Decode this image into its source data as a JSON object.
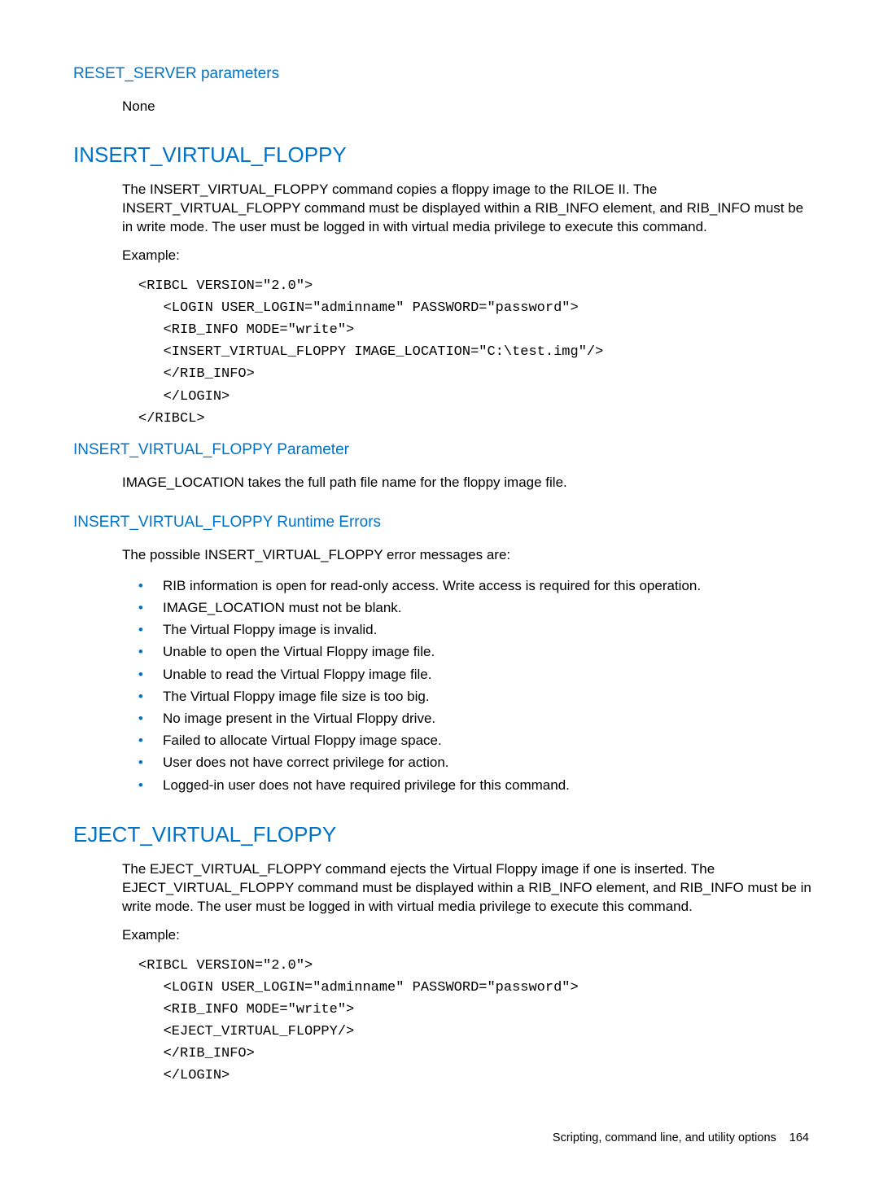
{
  "sections": {
    "reset_server_params": {
      "heading": "RESET_SERVER parameters",
      "body": "None"
    },
    "insert_virtual_floppy": {
      "heading": "INSERT_VIRTUAL_FLOPPY",
      "body": "The INSERT_VIRTUAL_FLOPPY command copies a floppy image to the RILOE II. The INSERT_VIRTUAL_FLOPPY command must be displayed within a RIB_INFO element, and RIB_INFO must be in write mode. The user must be logged in with virtual media privilege to execute this command.",
      "example_label": "Example:",
      "code": "<RIBCL VERSION=\"2.0\">\n   <LOGIN USER_LOGIN=\"adminname\" PASSWORD=\"password\">\n   <RIB_INFO MODE=\"write\">\n   <INSERT_VIRTUAL_FLOPPY IMAGE_LOCATION=\"C:\\test.img\"/>\n   </RIB_INFO>\n   </LOGIN>\n</RIBCL>"
    },
    "ivf_parameter": {
      "heading": "INSERT_VIRTUAL_FLOPPY Parameter",
      "body": "IMAGE_LOCATION takes the full path file name for the floppy image file."
    },
    "ivf_runtime_errors": {
      "heading": "INSERT_VIRTUAL_FLOPPY Runtime Errors",
      "intro": "The possible INSERT_VIRTUAL_FLOPPY error messages are:",
      "items": [
        "RIB information is open for read-only access. Write access is required for this operation.",
        "IMAGE_LOCATION must not be blank.",
        "The Virtual Floppy image is invalid.",
        "Unable to open the Virtual Floppy image file.",
        "Unable to read the Virtual Floppy image file.",
        "The Virtual Floppy image file size is too big.",
        "No image present in the Virtual Floppy drive.",
        "Failed to allocate Virtual Floppy image space.",
        "User does not have correct privilege for action.",
        "Logged-in user does not have required privilege for this command."
      ]
    },
    "eject_virtual_floppy": {
      "heading": "EJECT_VIRTUAL_FLOPPY",
      "body": "The EJECT_VIRTUAL_FLOPPY command ejects the Virtual Floppy image if one is inserted. The EJECT_VIRTUAL_FLOPPY command must be displayed within a RIB_INFO element, and RIB_INFO must be in write mode. The user must be logged in with virtual media privilege to execute this command.",
      "example_label": "Example:",
      "code": "<RIBCL VERSION=\"2.0\">\n   <LOGIN USER_LOGIN=\"adminname\" PASSWORD=\"password\">\n   <RIB_INFO MODE=\"write\">\n   <EJECT_VIRTUAL_FLOPPY/>\n   </RIB_INFO>\n   </LOGIN>"
    }
  },
  "footer": {
    "text": "Scripting, command line, and utility options",
    "page": "164"
  }
}
